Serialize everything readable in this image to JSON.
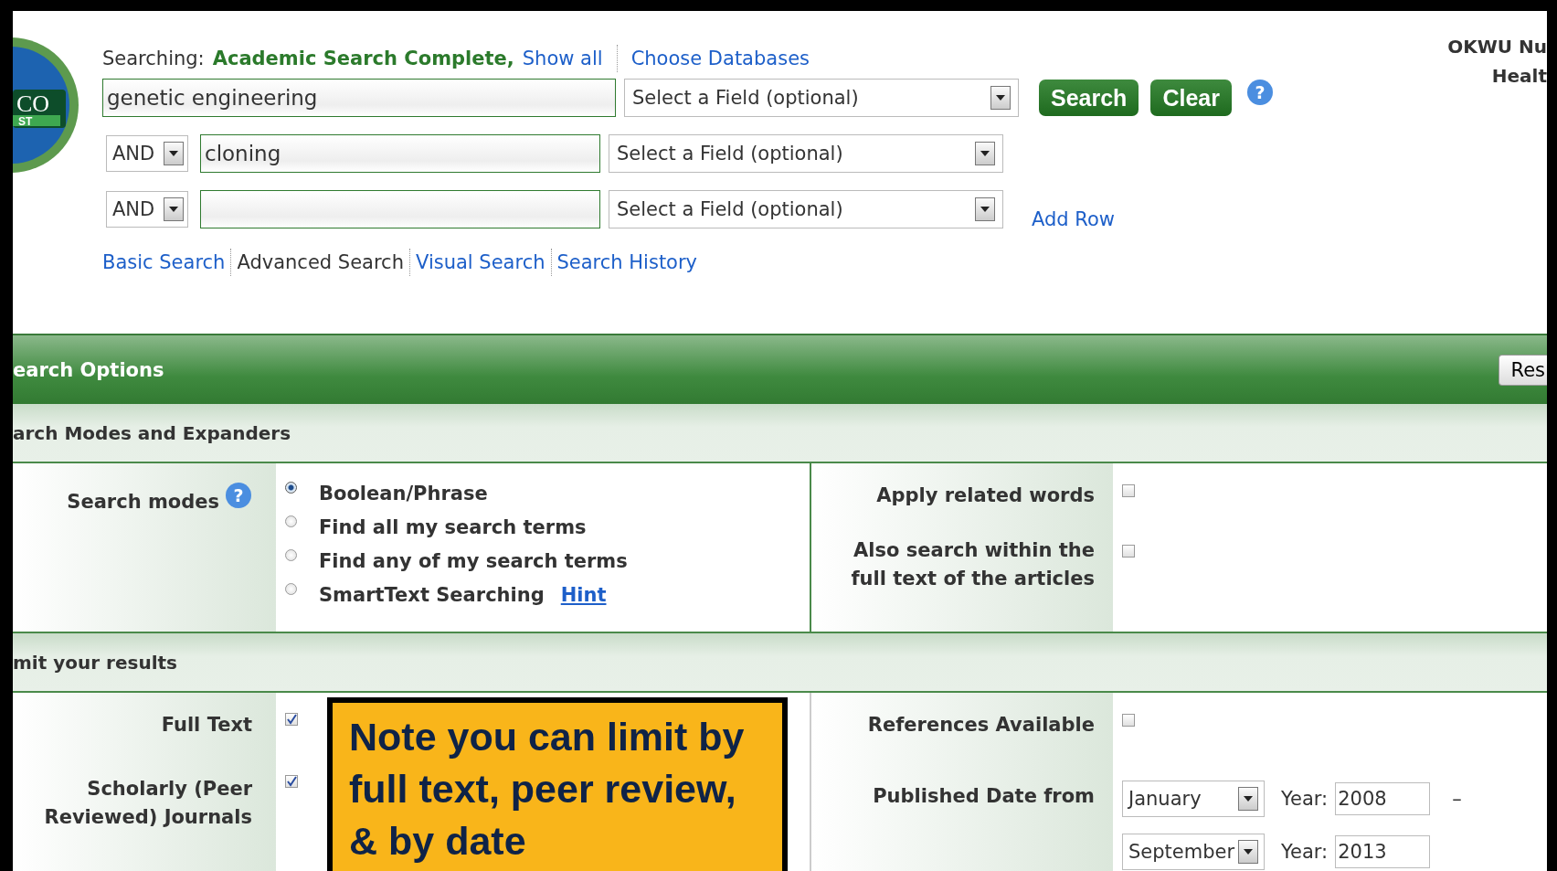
{
  "logo": {
    "top": "CO",
    "bottom": "ST"
  },
  "searching": {
    "label": "Searching:",
    "database": "Academic Search Complete,",
    "show_all": "Show all",
    "choose": "Choose Databases"
  },
  "search_rows": [
    {
      "value": "genetic engineering",
      "field": "Select a Field (optional)"
    },
    {
      "operator": "AND",
      "value": "cloning",
      "field": "Select a Field (optional)"
    },
    {
      "operator": "AND",
      "field": "Select a Field (optional)"
    }
  ],
  "buttons": [
    {
      "label": "Search"
    },
    {
      "label": "Clear"
    }
  ],
  "help": "?",
  "add_row": "Add Row",
  "user": [
    "OKWU Nu",
    "Healt"
  ],
  "tabs": [
    {
      "label": "Basic Search",
      "selected": false
    },
    {
      "label": "Advanced Search",
      "selected": true
    },
    {
      "label": "Visual Search",
      "selected": false
    },
    {
      "label": "Search History",
      "selected": false
    }
  ],
  "options_bar": {
    "title": "earch Options",
    "button": "Res"
  },
  "modes_section": {
    "title": "arch Modes and Expanders",
    "modes_label": "Search modes",
    "help": "?",
    "modes": [
      {
        "label": "Boolean/Phrase",
        "selected": true
      },
      {
        "label": "Find all my search terms",
        "selected": false
      },
      {
        "label": "Find any of my search terms",
        "selected": false
      },
      {
        "label": "SmartText Searching",
        "selected": false,
        "hint": "Hint"
      }
    ],
    "expanders": [
      {
        "label": "Apply related words",
        "checked": false
      },
      {
        "label": "Also search within the full text of the articles",
        "checked": false
      }
    ]
  },
  "limits_section": {
    "title": "mit your results",
    "left": [
      {
        "label": "Full Text",
        "checked": true
      },
      {
        "label": "Scholarly (Peer Reviewed) Journals",
        "checked": true
      }
    ],
    "right": [
      {
        "kind": "checkbox",
        "label": "References Available",
        "checked": false
      },
      {
        "kind": "date",
        "label": "Published Date from",
        "month_from": "January",
        "year_from_label": "Year:",
        "year_from": "2008",
        "separator": "–",
        "month_to": "September",
        "year_to_label": "Year:",
        "year_to": "2013"
      }
    ]
  },
  "callout": {
    "text": "Note you can limit by full text, peer review, & by date"
  }
}
